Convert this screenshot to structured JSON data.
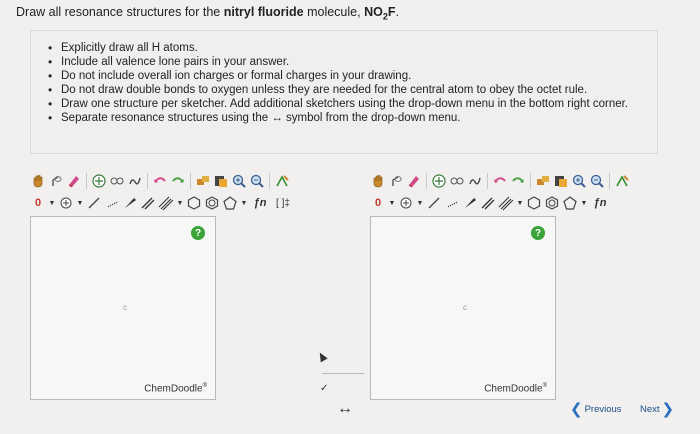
{
  "question": {
    "prefix": "Draw all resonance structures for the ",
    "molecule_name": "nitryl fluoride",
    "middle": " molecule, ",
    "formula_a": "NO",
    "formula_sub": "2",
    "formula_b": "F",
    "suffix": "."
  },
  "instructions": [
    "Explicitly draw all H atoms.",
    "Include all valence lone pairs in your answer.",
    "Do not include overall ion charges or formal charges in your drawing.",
    "Do not draw double bonds to oxygen unless they are needed for the central atom to obey the octet rule.",
    "Draw one structure per sketcher. Add additional sketchers using the drop-down menu in the bottom right corner.",
    "Separate resonance structures using the ↔ symbol from the drop-down menu."
  ],
  "sketchers": [
    {
      "brand": "ChemDoodle",
      "brand_mark": "®",
      "help": "?",
      "center_mark": "c",
      "charge_label": "0",
      "func_label": "ƒn",
      "bracket_label": "[ ]‡"
    },
    {
      "brand": "ChemDoodle",
      "brand_mark": "®",
      "help": "?",
      "center_mark": "c",
      "charge_label": "0",
      "func_label": "ƒn"
    }
  ],
  "resonance_symbol": "↔",
  "dropdown_check": "✓",
  "nav": {
    "previous": "Previous",
    "next": "Next"
  },
  "colors": {
    "accent": "#2a6fc0",
    "help_green": "#3aa43a",
    "panel_bg": "#eef0ee"
  }
}
